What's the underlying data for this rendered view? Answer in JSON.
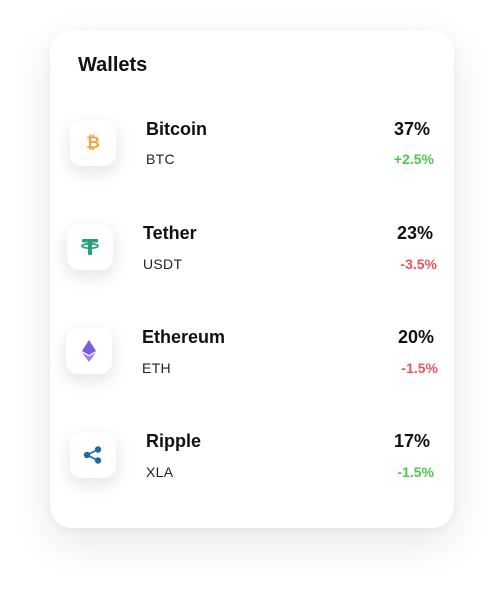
{
  "wallets": {
    "title": "Wallets",
    "items": [
      {
        "name": "Bitcoin",
        "symbol": "BTC",
        "percent": "37%",
        "change": "+2.5%",
        "trend": "up",
        "icon": "bitcoin-icon",
        "icon_color": "#F7A23B"
      },
      {
        "name": "Tether",
        "symbol": "USDT",
        "percent": "23%",
        "change": "-3.5%",
        "trend": "down",
        "icon": "tether-icon",
        "icon_color": "#26A17B"
      },
      {
        "name": "Ethereum",
        "symbol": "ETH",
        "percent": "20%",
        "change": "-1.5%",
        "trend": "down",
        "icon": "ethereum-icon",
        "icon_color": "#7B5CE0"
      },
      {
        "name": "Ripple",
        "symbol": "XLA",
        "percent": "17%",
        "change": "-1.5%",
        "trend": "up",
        "icon": "ripple-icon",
        "icon_color": "#1B6CA8"
      }
    ]
  },
  "colors": {
    "positive": "#4CC84A",
    "negative": "#E8545B"
  }
}
